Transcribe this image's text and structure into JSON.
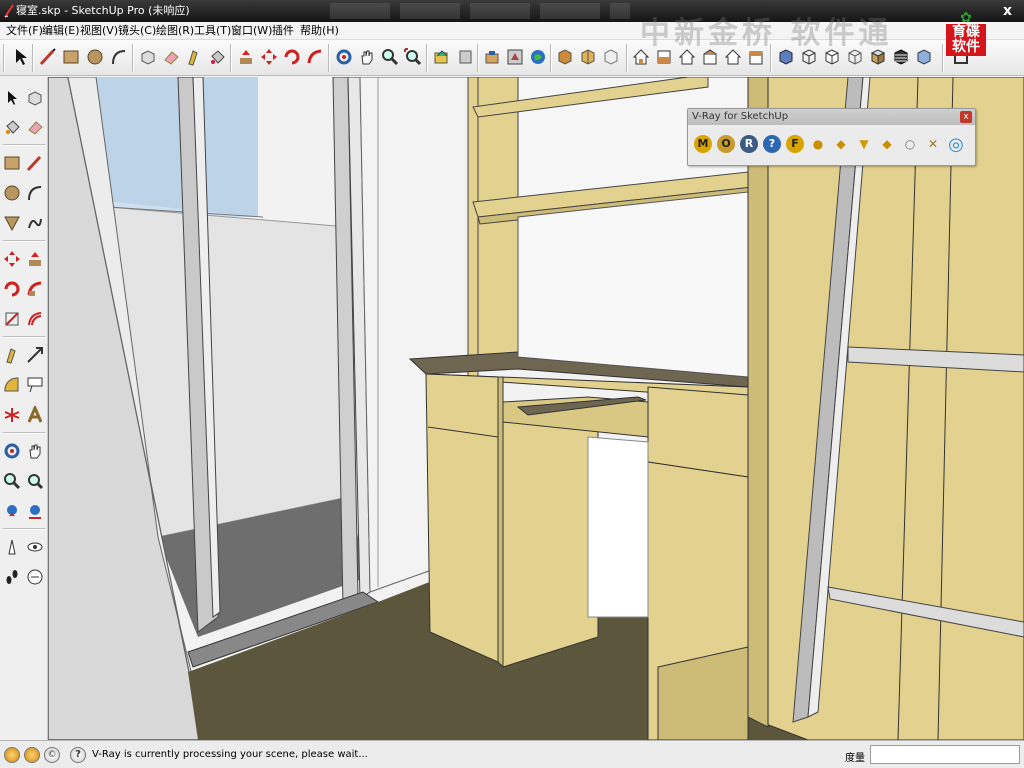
{
  "window": {
    "title": "寝室.skp - SketchUp Pro (未响应)",
    "close_glyph": "x"
  },
  "menu": {
    "items": [
      "文件(F)",
      "编辑(E)",
      "视图(V)",
      "镜头(C)",
      "绘图(R)",
      "工具(T)",
      "窗口(W)",
      "插件",
      "帮助(H)"
    ]
  },
  "toolbar": {
    "icons": [
      "select-icon",
      "line-icon",
      "rectangle-icon",
      "circle-icon",
      "arc-icon",
      "make-component-icon",
      "eraser-icon",
      "tape-measure-icon",
      "paint-bucket-icon",
      "push-pull-icon",
      "move-icon",
      "rotate-icon",
      "follow-me-icon",
      "orbit-icon",
      "pan-icon",
      "zoom-icon",
      "zoom-extents-icon",
      "previous-view-icon",
      "next-view-icon",
      "add-location-icon",
      "google-earth-icon",
      "get-models-icon",
      "share-model-icon",
      "components-icon",
      "iso-view-icon",
      "top-view-icon",
      "front-view-icon",
      "right-view-icon",
      "back-view-icon",
      "left-view-icon",
      "xray-icon",
      "wireframe-icon",
      "hidden-line-icon",
      "shaded-icon",
      "shaded-texture-icon",
      "monochrome-icon",
      "section-icon"
    ]
  },
  "watermark": {
    "text": "中新金桥 软件通",
    "logo_text": "育碟软件"
  },
  "vray": {
    "title": "V-Ray for SketchUp",
    "close_glyph": "x",
    "buttons": [
      {
        "name": "material-editor",
        "glyph": "M"
      },
      {
        "name": "options-editor",
        "glyph": "O"
      },
      {
        "name": "render",
        "glyph": "R"
      },
      {
        "name": "help",
        "glyph": "?"
      },
      {
        "name": "frame-buffer",
        "glyph": "F"
      },
      {
        "name": "sphere-light",
        "glyph": "●"
      },
      {
        "name": "omni-light",
        "glyph": "◆"
      },
      {
        "name": "spot-light",
        "glyph": "▼"
      },
      {
        "name": "ies-light",
        "glyph": "◆"
      },
      {
        "name": "dome-light",
        "glyph": "○"
      },
      {
        "name": "infinite-plane",
        "glyph": "✕"
      },
      {
        "name": "vray-logo",
        "glyph": "◎"
      }
    ]
  },
  "status": {
    "message": "V-Ray is currently processing your scene, please wait...",
    "measurements_label": "度量",
    "measurements_value": ""
  },
  "colors": {
    "wood": "#e3d28f",
    "wood_dark": "#cdbb78",
    "floor": "#5b563c",
    "balcony_floor": "#6e6e6e",
    "sky": "#cfe0ef",
    "wall": "#f3f3f3"
  }
}
